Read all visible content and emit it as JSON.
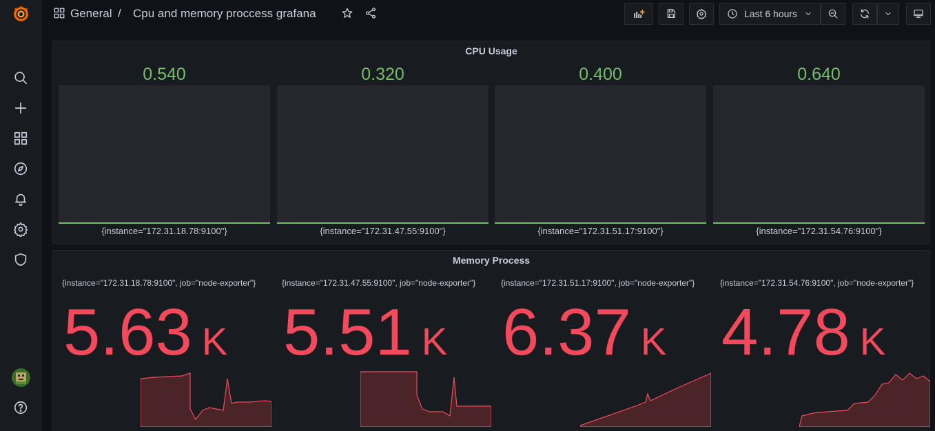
{
  "header": {
    "breadcrumb_root": "General",
    "separator": "/",
    "dashboard_title": "Cpu and memory proccess grafana",
    "time_range": "Last 6 hours"
  },
  "panels": {
    "cpu": {
      "title": "CPU Usage",
      "gauges": [
        {
          "value": "0.540",
          "label": "{instance=\"172.31.18.78:9100\"}"
        },
        {
          "value": "0.320",
          "label": "{instance=\"172.31.47.55:9100\"}"
        },
        {
          "value": "0.400",
          "label": "{instance=\"172.31.51.17:9100\"}"
        },
        {
          "value": "0.640",
          "label": "{instance=\"172.31.54.76:9100\"}"
        }
      ]
    },
    "memory": {
      "title": "Memory Process",
      "stats": [
        {
          "label": "{instance=\"172.31.18.78:9100\", job=\"node-exporter\"}",
          "value": "5.63",
          "unit": "K"
        },
        {
          "label": "{instance=\"172.31.47.55:9100\", job=\"node-exporter\"}",
          "value": "5.51",
          "unit": "K"
        },
        {
          "label": "{instance=\"172.31.51.17:9100\", job=\"node-exporter\"}",
          "value": "6.37",
          "unit": "K"
        },
        {
          "label": "{instance=\"172.31.54.76:9100\", job=\"node-exporter\"}",
          "value": "4.78",
          "unit": "K"
        }
      ]
    }
  },
  "colors": {
    "cpu_value": "#73bf69",
    "memory_value": "#f2495c",
    "sparkline_fill": "#4a2427"
  },
  "icons": {
    "sidebar": [
      "grafana-logo-icon",
      "search-icon",
      "plus-icon",
      "dashboards-icon",
      "explore-icon",
      "alerting-icon",
      "settings-icon",
      "shield-icon",
      "avatar",
      "help-icon"
    ],
    "toolbar": [
      "add-panel-icon",
      "save-icon",
      "gear-icon",
      "clock-icon",
      "chevron-down-icon",
      "zoom-out-icon",
      "refresh-icon",
      "chevron-down-icon",
      "tv-mode-icon"
    ]
  }
}
